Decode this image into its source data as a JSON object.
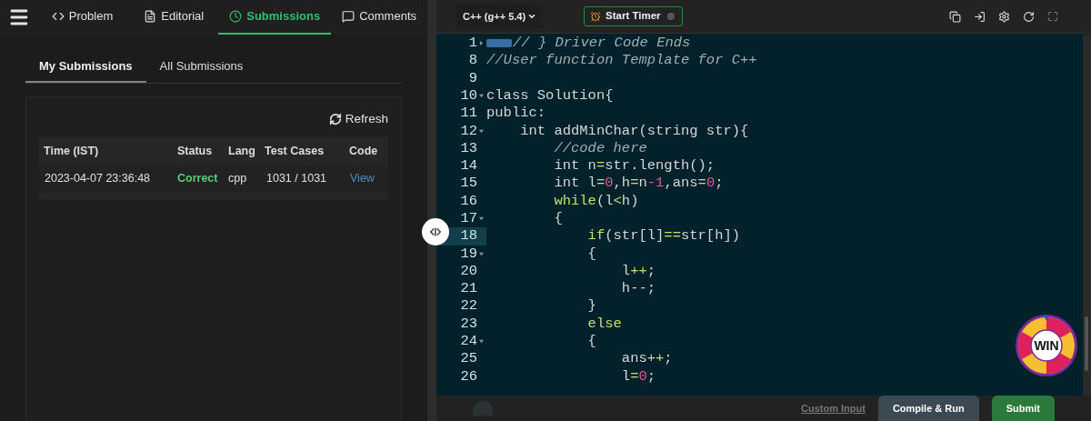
{
  "problem_tabs": [
    {
      "label": "Problem",
      "selected": false
    },
    {
      "label": "Editorial",
      "selected": false
    },
    {
      "label": "Submissions",
      "selected": true
    },
    {
      "label": "Comments",
      "selected": false
    }
  ],
  "submission_tabs": [
    {
      "label": "My Submissions",
      "selected": true
    },
    {
      "label": "All Submissions",
      "selected": false
    }
  ],
  "refresh_label": "Refresh",
  "table": {
    "columns": [
      "Time (IST)",
      "Status",
      "Lang",
      "Test Cases",
      "Code"
    ],
    "rows": [
      {
        "cells": [
          "2023-04-07 23:36:48",
          "Correct",
          "cpp",
          "1031 / 1031",
          "View"
        ]
      }
    ]
  },
  "editor": {
    "language": "C++ (g++ 5.4)",
    "timer_label": "Start Timer",
    "lines": [
      {
        "number": "1",
        "fold_marker": true,
        "folded": true,
        "active": false,
        "tokens": [
          {
            "kind": "comment",
            "text": "// } Driver Code Ends"
          }
        ]
      },
      {
        "number": "8",
        "fold_marker": false,
        "folded": false,
        "active": false,
        "tokens": [
          {
            "kind": "comment",
            "text": "//User function Template for C++"
          }
        ]
      },
      {
        "number": "9",
        "fold_marker": false,
        "folded": false,
        "active": false
      },
      {
        "number": "10",
        "fold_marker": true,
        "folded": false,
        "active": false,
        "tokens": [
          {
            "kind": "text",
            "text": "class Solution{"
          }
        ]
      },
      {
        "number": "11",
        "fold_marker": false,
        "folded": false,
        "active": false,
        "tokens": [
          {
            "kind": "text",
            "text": "public:"
          }
        ]
      },
      {
        "number": "12",
        "fold_marker": true,
        "folded": false,
        "active": false,
        "tokens": [
          {
            "kind": "text",
            "text": "    int addMinChar(string str){"
          }
        ]
      },
      {
        "number": "13",
        "fold_marker": false,
        "folded": false,
        "active": false,
        "tokens": [
          {
            "kind": "comment",
            "text": "        //code here"
          }
        ]
      },
      {
        "number": "14",
        "fold_marker": false,
        "folded": false,
        "active": false,
        "tokens": [
          {
            "kind": "text",
            "text": "        int n"
          },
          {
            "kind": "operator",
            "text": "="
          },
          {
            "kind": "text",
            "text": "str.length();"
          }
        ]
      },
      {
        "number": "15",
        "fold_marker": false,
        "folded": false,
        "active": false,
        "tokens": [
          {
            "kind": "text",
            "text": "        int l"
          },
          {
            "kind": "operator",
            "text": "="
          },
          {
            "kind": "number",
            "text": "0"
          },
          {
            "kind": "text",
            "text": ",h"
          },
          {
            "kind": "operator",
            "text": "="
          },
          {
            "kind": "text",
            "text": "n"
          },
          {
            "kind": "number",
            "text": "-1"
          },
          {
            "kind": "text",
            "text": ",ans"
          },
          {
            "kind": "operator",
            "text": "="
          },
          {
            "kind": "number",
            "text": "0"
          },
          {
            "kind": "text",
            "text": ";"
          }
        ]
      },
      {
        "number": "16",
        "fold_marker": false,
        "folded": false,
        "active": false,
        "tokens": [
          {
            "kind": "keyword",
            "text": "        while"
          },
          {
            "kind": "text",
            "text": "(l"
          },
          {
            "kind": "operator",
            "text": "<"
          },
          {
            "kind": "text",
            "text": "h)"
          }
        ]
      },
      {
        "number": "17",
        "fold_marker": true,
        "folded": false,
        "active": false,
        "tokens": [
          {
            "kind": "text",
            "text": "        {"
          }
        ]
      },
      {
        "number": "18",
        "fold_marker": false,
        "folded": false,
        "active": true,
        "tokens": [
          {
            "kind": "keyword",
            "text": "            if"
          },
          {
            "kind": "text",
            "text": "(str[l]"
          },
          {
            "kind": "operator",
            "text": "=="
          },
          {
            "kind": "text",
            "text": "str[h])"
          }
        ]
      },
      {
        "number": "19",
        "fold_marker": true,
        "folded": false,
        "active": false,
        "tokens": [
          {
            "kind": "text",
            "text": "            {"
          }
        ]
      },
      {
        "number": "20",
        "fold_marker": false,
        "folded": false,
        "active": false,
        "tokens": [
          {
            "kind": "text",
            "text": "                l"
          },
          {
            "kind": "operator",
            "text": "++"
          },
          {
            "kind": "text",
            "text": ";"
          }
        ]
      },
      {
        "number": "21",
        "fold_marker": false,
        "folded": false,
        "active": false,
        "tokens": [
          {
            "kind": "text",
            "text": "                h--;"
          }
        ]
      },
      {
        "number": "22",
        "fold_marker": false,
        "folded": false,
        "active": false,
        "tokens": [
          {
            "kind": "text",
            "text": "            }"
          }
        ]
      },
      {
        "number": "23",
        "fold_marker": false,
        "folded": false,
        "active": false,
        "tokens": [
          {
            "kind": "keyword",
            "text": "            else"
          }
        ]
      },
      {
        "number": "24",
        "fold_marker": true,
        "folded": false,
        "active": false,
        "tokens": [
          {
            "kind": "text",
            "text": "            {"
          }
        ]
      },
      {
        "number": "25",
        "fold_marker": false,
        "folded": false,
        "active": false,
        "tokens": [
          {
            "kind": "text",
            "text": "                ans"
          },
          {
            "kind": "operator",
            "text": "++"
          },
          {
            "kind": "text",
            "text": ";"
          }
        ]
      },
      {
        "number": "26",
        "fold_marker": false,
        "folded": false,
        "active": false,
        "tokens": [
          {
            "kind": "text",
            "text": "                l"
          },
          {
            "kind": "operator",
            "text": "="
          },
          {
            "kind": "number",
            "text": "0"
          },
          {
            "kind": "text",
            "text": ";"
          }
        ]
      }
    ]
  },
  "win_badge": "WIN",
  "footer": {
    "custom_input": "Custom Input",
    "compile_run": "Compile & Run",
    "submit": "Submit"
  }
}
